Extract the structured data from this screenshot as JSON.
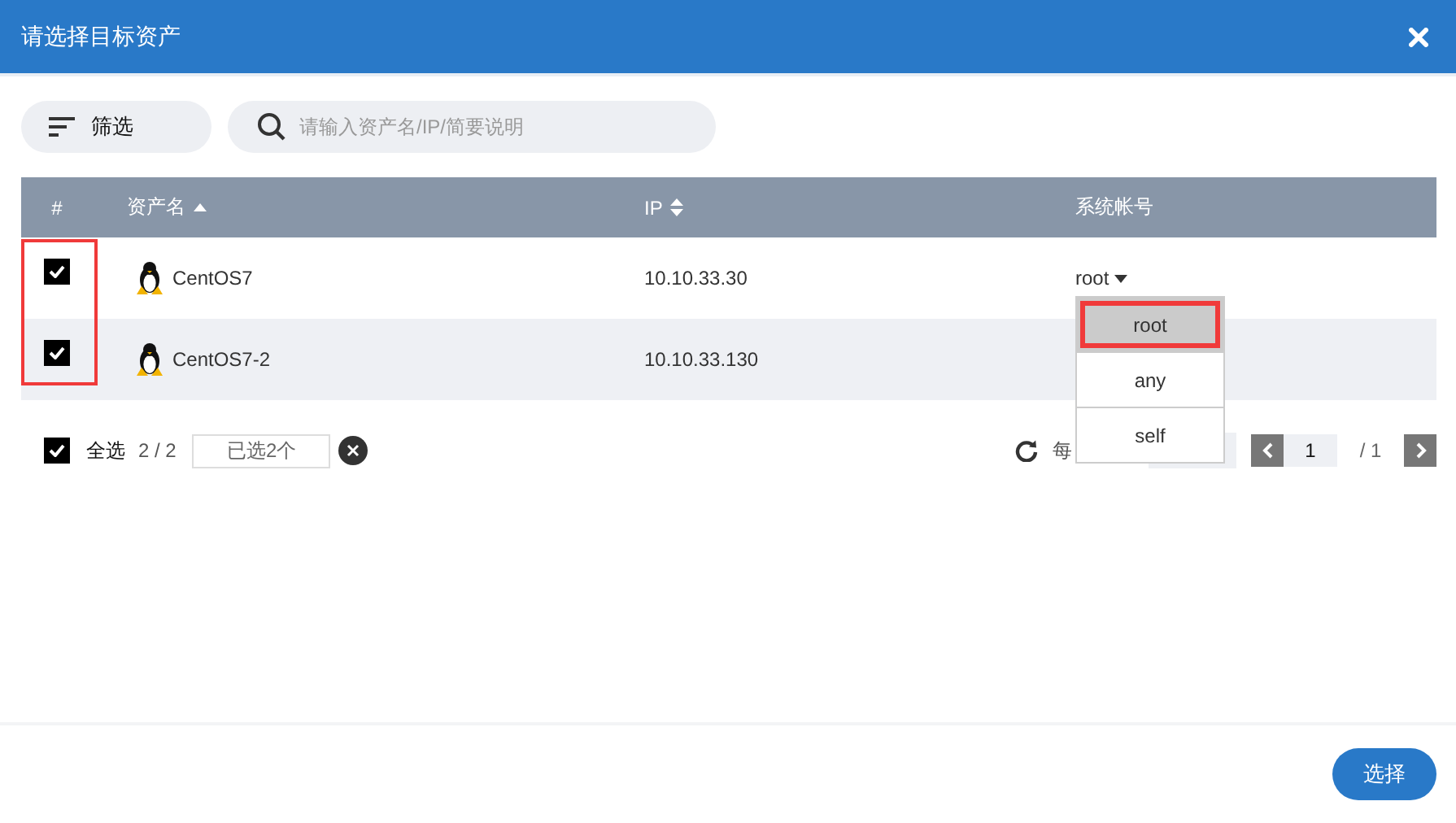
{
  "dialog": {
    "title": "请选择目标资产"
  },
  "toolbar": {
    "filter_label": "筛选",
    "search": {
      "placeholder": "请输入资产名/IP/简要说明"
    }
  },
  "table": {
    "columns": [
      {
        "label": "#",
        "sortable": false
      },
      {
        "label": "资产名",
        "sortable": true,
        "sorted": true
      },
      {
        "label": "IP",
        "sortable": true,
        "sorted": false
      },
      {
        "label": "系统帐号",
        "sortable": false
      }
    ],
    "rows": [
      {
        "checked": true,
        "name": "CentOS7",
        "ip": "10.10.33.30",
        "account": "root"
      },
      {
        "checked": true,
        "name": "CentOS7-2",
        "ip": "10.10.33.130"
      }
    ]
  },
  "account_dropdown": {
    "options": [
      {
        "label": "root",
        "selected": true
      },
      {
        "label": "any",
        "selected": false
      },
      {
        "label": "self",
        "selected": false
      }
    ]
  },
  "footer": {
    "select_all": {
      "checked": true,
      "label": "全选"
    },
    "count": "2 / 2",
    "selected_field": "已选2个",
    "page_size_label": "每",
    "page": "1",
    "total_pages": "/ 1"
  },
  "confirm_button": "选择"
}
